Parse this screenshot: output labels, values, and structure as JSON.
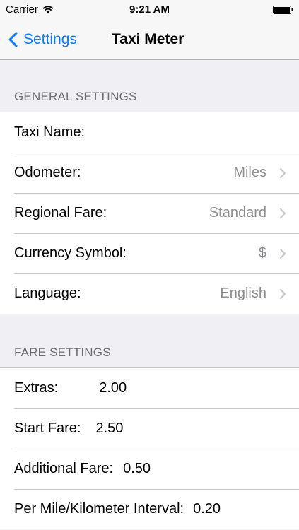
{
  "status_bar": {
    "carrier": "Carrier",
    "time": "9:21 AM"
  },
  "nav": {
    "back_label": "Settings",
    "title": "Taxi Meter"
  },
  "general": {
    "header": "GENERAL SETTINGS",
    "rows": [
      {
        "label": "Taxi Name:",
        "value": ""
      },
      {
        "label": "Odometer:",
        "value": "Miles"
      },
      {
        "label": "Regional Fare:",
        "value": "Standard"
      },
      {
        "label": "Currency Symbol:",
        "value": "$"
      },
      {
        "label": "Language:",
        "value": "English"
      }
    ]
  },
  "fare": {
    "header": "FARE SETTINGS",
    "rows": [
      {
        "label": "Extras:",
        "value": "2.00"
      },
      {
        "label": "Start Fare:",
        "value": "2.50"
      },
      {
        "label": "Additional Fare:",
        "value": "0.50"
      },
      {
        "label": "Per Mile/Kilometer Interval:",
        "value": "0.20"
      }
    ]
  },
  "colors": {
    "accent": "#0a7aff",
    "background": "#efeff4",
    "secondary_text": "#8e8e93"
  }
}
